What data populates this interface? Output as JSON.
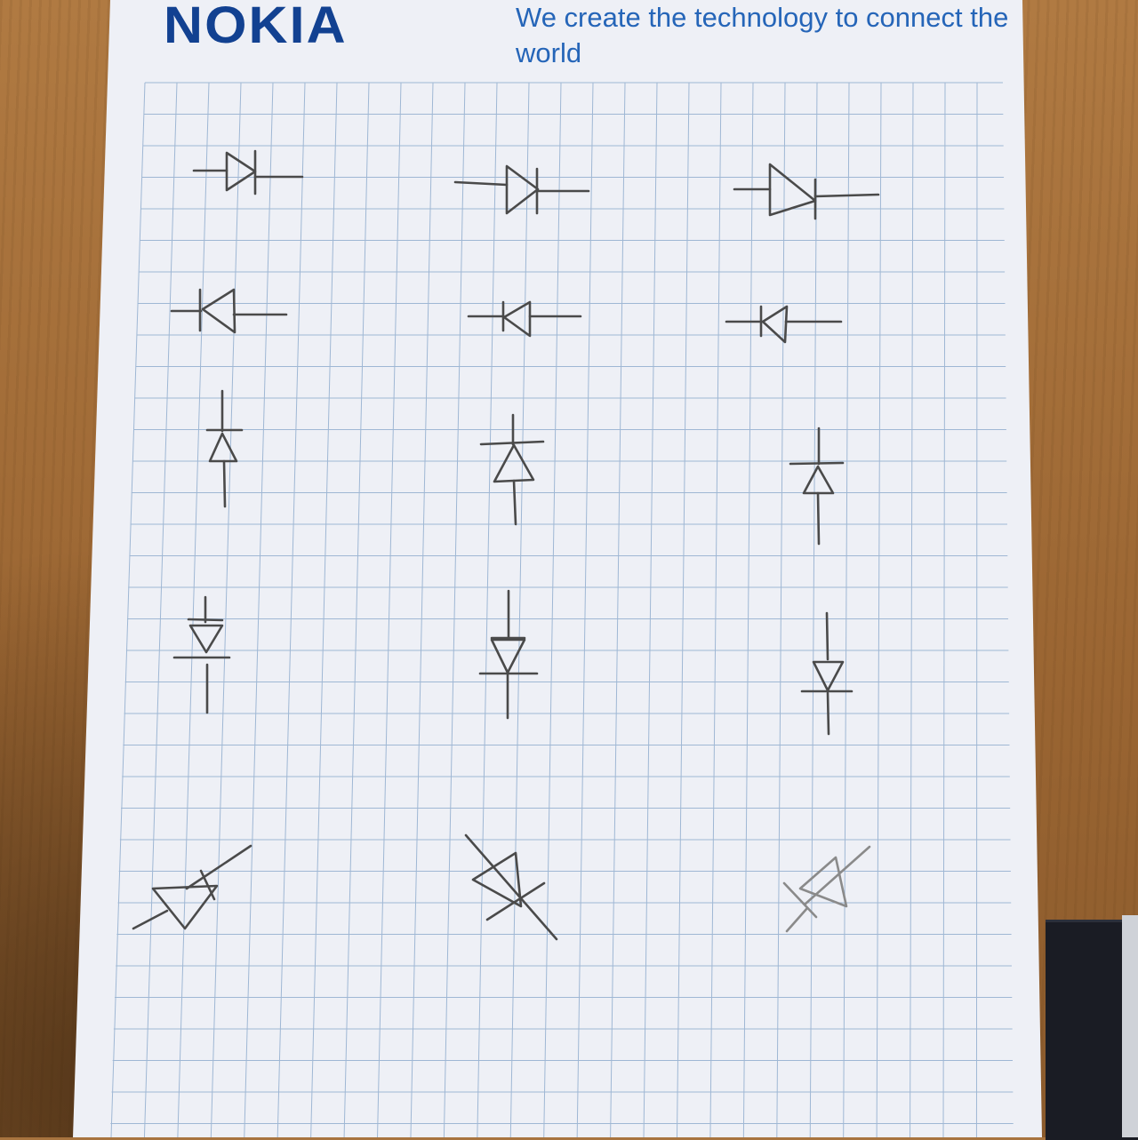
{
  "header": {
    "brand": "NOKIA",
    "tagline": "We create the technology to connect the world"
  },
  "colors": {
    "brand_blue": "#124191",
    "tagline_blue": "#2565b8",
    "grid_line": "#9fb7d4",
    "ink": "#4a4a4a"
  },
  "sketch": {
    "subject": "hand-drawn diode symbols",
    "rows": [
      {
        "orientation": "pointing right",
        "count": 3
      },
      {
        "orientation": "pointing left",
        "count": 3
      },
      {
        "orientation": "pointing up",
        "count": 3
      },
      {
        "orientation": "pointing down",
        "count": 3
      },
      {
        "orientation": "diagonal",
        "count": 3
      }
    ]
  }
}
